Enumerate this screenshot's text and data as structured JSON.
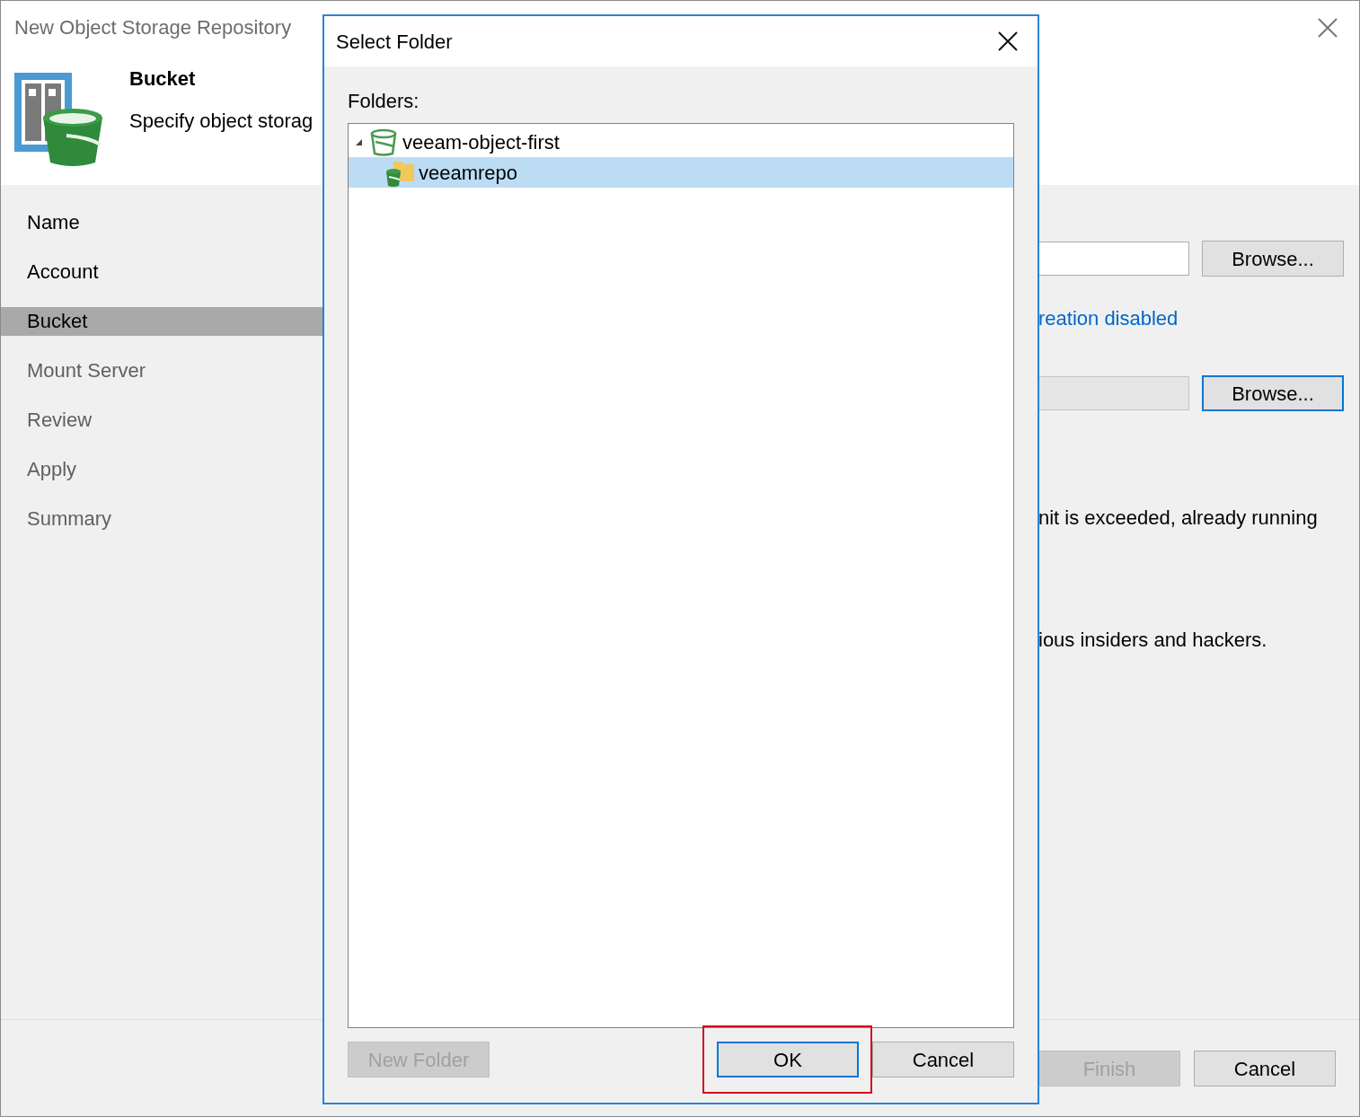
{
  "wizard": {
    "title": "New Object Storage Repository",
    "header": {
      "title": "Bucket",
      "subtitle": "Specify object storag"
    },
    "steps": [
      {
        "label": "Name",
        "selected": false,
        "completed": true
      },
      {
        "label": "Account",
        "selected": false,
        "completed": true
      },
      {
        "label": "Bucket",
        "selected": true,
        "completed": true
      },
      {
        "label": "Mount Server",
        "selected": false,
        "completed": false
      },
      {
        "label": "Review",
        "selected": false,
        "completed": false
      },
      {
        "label": "Apply",
        "selected": false,
        "completed": false
      },
      {
        "label": "Summary",
        "selected": false,
        "completed": false
      }
    ],
    "content": [
      {
        "kind": "browse",
        "disabled": false,
        "focused": false,
        "button": "Browse..."
      },
      {
        "kind": "link",
        "text": "reation disabled"
      },
      {
        "kind": "browse",
        "disabled": true,
        "focused": true,
        "button": "Browse..."
      },
      {
        "kind": "text",
        "text": "nit is exceeded, already running"
      },
      {
        "kind": "text",
        "text": "ious insiders and hackers."
      }
    ],
    "buttons": [
      {
        "label": "Finish",
        "disabled": true
      },
      {
        "label": "Cancel",
        "disabled": false
      }
    ]
  },
  "dialog": {
    "title": "Select Folder",
    "folders_label": "Folders:",
    "tree": [
      {
        "label": "veeam-object-first",
        "kind": "bucket",
        "expanded": true,
        "selected": false,
        "children": [
          {
            "label": "veeamrepo",
            "kind": "folder",
            "selected": true
          }
        ]
      }
    ],
    "buttons": [
      {
        "label": "New Folder",
        "disabled": true,
        "focused": false,
        "highlighted": false
      },
      {
        "label": "OK",
        "disabled": false,
        "focused": true,
        "highlighted": true
      },
      {
        "label": "Cancel",
        "disabled": false,
        "focused": false,
        "highlighted": false
      }
    ]
  }
}
